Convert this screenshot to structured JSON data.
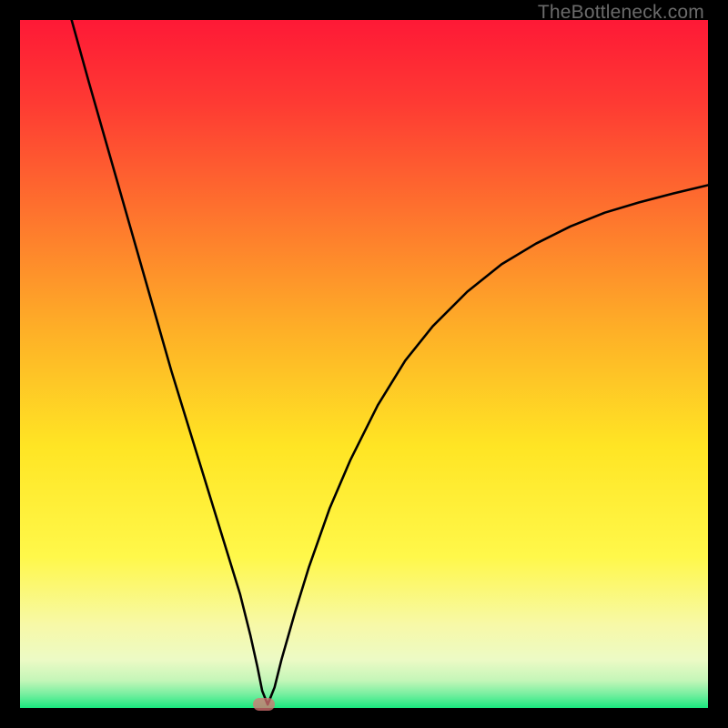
{
  "watermark": "TheBottleneck.com",
  "chart_data": {
    "type": "line",
    "title": "",
    "xlabel": "",
    "ylabel": "",
    "xlim": [
      0,
      100
    ],
    "ylim": [
      0,
      100
    ],
    "grid": false,
    "legend": false,
    "background_gradient": {
      "top": "#fe1936",
      "upper_mid": "#fe8f2b",
      "mid": "#ffe524",
      "lower_mid": "#f9f988",
      "bottom": "#19e87e"
    },
    "series": [
      {
        "name": "bottleneck-curve",
        "color": "#000000",
        "x": [
          7.5,
          10,
          12,
          14,
          16,
          18,
          20,
          22,
          24,
          26,
          28,
          30,
          32,
          33.5,
          34.5,
          35.2,
          36,
          37,
          38,
          40,
          42,
          45,
          48,
          52,
          56,
          60,
          65,
          70,
          75,
          80,
          85,
          90,
          95,
          100
        ],
        "y": [
          100,
          91,
          84,
          77,
          70,
          63,
          56,
          49,
          42.5,
          36,
          29.5,
          23,
          16.5,
          10.5,
          6,
          2.5,
          0.5,
          3,
          7,
          14,
          20.5,
          29,
          36,
          44,
          50.5,
          55.5,
          60.5,
          64.5,
          67.5,
          70,
          72,
          73.5,
          74.8,
          76
        ]
      }
    ],
    "marker": {
      "x": 35.4,
      "y": 0.5,
      "color": "#d97373"
    }
  }
}
